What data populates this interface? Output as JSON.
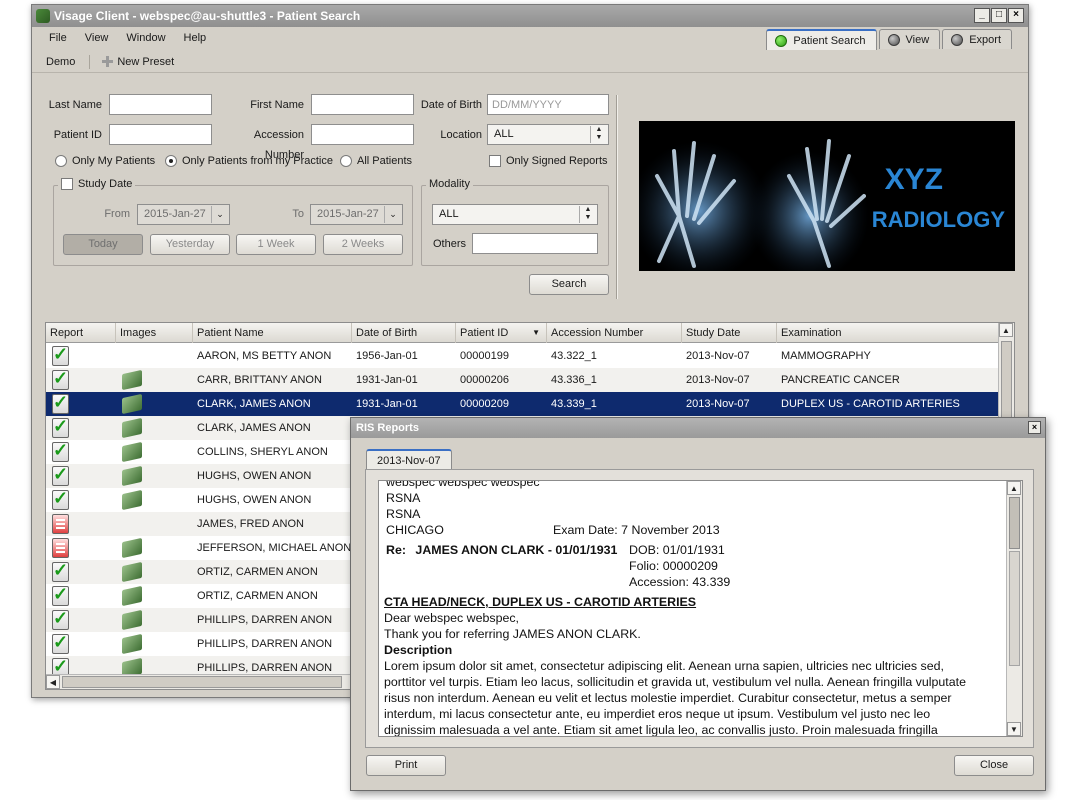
{
  "window": {
    "title": "Visage Client - webspec@au-shuttle3 - Patient Search",
    "controls": [
      "_",
      "□",
      "×"
    ]
  },
  "menu": [
    "File",
    "View",
    "Window",
    "Help"
  ],
  "top_tabs": [
    {
      "label": "Patient Search",
      "status": "green"
    },
    {
      "label": "View",
      "status": "grey"
    },
    {
      "label": "Export",
      "status": "grey"
    }
  ],
  "toolbar": {
    "demo_label": "Demo",
    "new_preset_label": "New Preset"
  },
  "search": {
    "last_name_label": "Last Name",
    "last_name_value": "",
    "first_name_label": "First Name",
    "first_name_value": "",
    "dob_label": "Date of Birth",
    "dob_placeholder": "DD/MM/YYYY",
    "patient_id_label": "Patient ID",
    "patient_id_value": "",
    "accession_label": "Accession Number",
    "accession_value": "",
    "location_label": "Location",
    "location_value": "ALL",
    "radio_options": [
      "Only My Patients",
      "Only Patients from my Practice",
      "All Patients"
    ],
    "radio_selected_index": 1,
    "only_signed_label": "Only Signed Reports",
    "only_signed_checked": false,
    "study_date": {
      "label": "Study Date",
      "checked": false,
      "from_label": "From",
      "from_value": "2015-Jan-27",
      "to_label": "To",
      "to_value": "2015-Jan-27",
      "buttons": [
        "Today",
        "Yesterday",
        "1 Week",
        "2 Weeks"
      ]
    },
    "modality": {
      "label": "Modality",
      "value": "ALL",
      "others_label": "Others",
      "others_value": ""
    },
    "search_button": "Search"
  },
  "banner": {
    "line1": "XYZ",
    "line2": "RADIOLOGY"
  },
  "grid": {
    "columns": [
      "Report",
      "Images",
      "Patient Name",
      "Date of Birth",
      "Patient ID",
      "Accession Number",
      "Study Date",
      "Examination"
    ],
    "selected_index": 2,
    "rows": [
      {
        "report": "ok",
        "images": false,
        "name": "AARON, MS BETTY ANON",
        "dob": "1956-Jan-01",
        "pid": "00000199",
        "acc": "43.322_1",
        "study": "2013-Nov-07",
        "exam": "MAMMOGRAPHY"
      },
      {
        "report": "ok",
        "images": true,
        "name": "CARR, BRITTANY ANON",
        "dob": "1931-Jan-01",
        "pid": "00000206",
        "acc": "43.336_1",
        "study": "2013-Nov-07",
        "exam": "PANCREATIC CANCER"
      },
      {
        "report": "ok",
        "images": true,
        "name": "CLARK, JAMES ANON",
        "dob": "1931-Jan-01",
        "pid": "00000209",
        "acc": "43.339_1",
        "study": "2013-Nov-07",
        "exam": "DUPLEX US - CAROTID ARTERIES"
      },
      {
        "report": "ok",
        "images": true,
        "name": "CLARK, JAMES ANON",
        "dob": "",
        "pid": "",
        "acc": "",
        "study": "",
        "exam": ""
      },
      {
        "report": "ok",
        "images": true,
        "name": "COLLINS, SHERYL ANON",
        "dob": "",
        "pid": "",
        "acc": "",
        "study": "",
        "exam": ""
      },
      {
        "report": "ok",
        "images": true,
        "name": "HUGHS, OWEN ANON",
        "dob": "",
        "pid": "",
        "acc": "",
        "study": "",
        "exam": ""
      },
      {
        "report": "ok",
        "images": true,
        "name": "HUGHS, OWEN ANON",
        "dob": "",
        "pid": "",
        "acc": "",
        "study": "",
        "exam": ""
      },
      {
        "report": "red",
        "images": false,
        "name": "JAMES, FRED ANON",
        "dob": "",
        "pid": "",
        "acc": "",
        "study": "",
        "exam": ""
      },
      {
        "report": "red",
        "images": true,
        "name": "JEFFERSON, MICHAEL ANON",
        "dob": "",
        "pid": "",
        "acc": "",
        "study": "",
        "exam": ""
      },
      {
        "report": "ok",
        "images": true,
        "name": "ORTIZ, CARMEN ANON",
        "dob": "",
        "pid": "",
        "acc": "",
        "study": "",
        "exam": ""
      },
      {
        "report": "ok",
        "images": true,
        "name": "ORTIZ, CARMEN ANON",
        "dob": "",
        "pid": "",
        "acc": "",
        "study": "",
        "exam": ""
      },
      {
        "report": "ok",
        "images": true,
        "name": "PHILLIPS, DARREN ANON",
        "dob": "",
        "pid": "",
        "acc": "",
        "study": "",
        "exam": ""
      },
      {
        "report": "ok",
        "images": true,
        "name": "PHILLIPS, DARREN ANON",
        "dob": "",
        "pid": "",
        "acc": "",
        "study": "",
        "exam": ""
      },
      {
        "report": "ok",
        "images": true,
        "name": "PHILLIPS, DARREN ANON",
        "dob": "",
        "pid": "",
        "acc": "",
        "study": "",
        "exam": ""
      }
    ]
  },
  "ris": {
    "title": "RIS Reports",
    "tab": "2013-Nov-07",
    "report": {
      "line_cut": "webspec webspec webspec",
      "line_rsna1": "RSNA",
      "line_rsna2": "RSNA",
      "city": "CHICAGO",
      "exam_date": "Exam Date: 7 November 2013",
      "re_label": "Re:",
      "re_name": "JAMES ANON CLARK - 01/01/1931",
      "dob": "DOB: 01/01/1931",
      "folio": "Folio: 00000209",
      "accession": "Accession: 43.339",
      "heading": "CTA HEAD/NECK, DUPLEX US - CAROTID ARTERIES",
      "greeting": "Dear webspec webspec,",
      "thanks": "Thank you for referring JAMES ANON CLARK.",
      "desc_heading": "Description",
      "body_lines": [
        "Lorem ipsum dolor sit amet, consectetur adipiscing elit. Aenean urna sapien, ultricies nec ultricies sed,",
        "porttitor vel turpis. Etiam leo lacus, sollicitudin et gravida ut, vestibulum vel nulla. Aenean fringilla vulputate",
        "risus non interdum. Aenean eu velit et lectus molestie imperdiet. Curabitur consectetur, metus a semper",
        "interdum, mi lacus consectetur ante, eu imperdiet eros neque ut ipsum. Vestibulum vel justo nec leo",
        "dignissim malesuada a vel ante. Etiam sit amet ligula leo, ac convallis justo. Proin malesuada fringilla"
      ]
    },
    "print_button": "Print",
    "close_button": "Close",
    "close_icon": "×"
  },
  "colors": {
    "selected_row": "#0e2a6e",
    "accent": "#2a86d4",
    "window_bg": "#d4d0c8"
  }
}
